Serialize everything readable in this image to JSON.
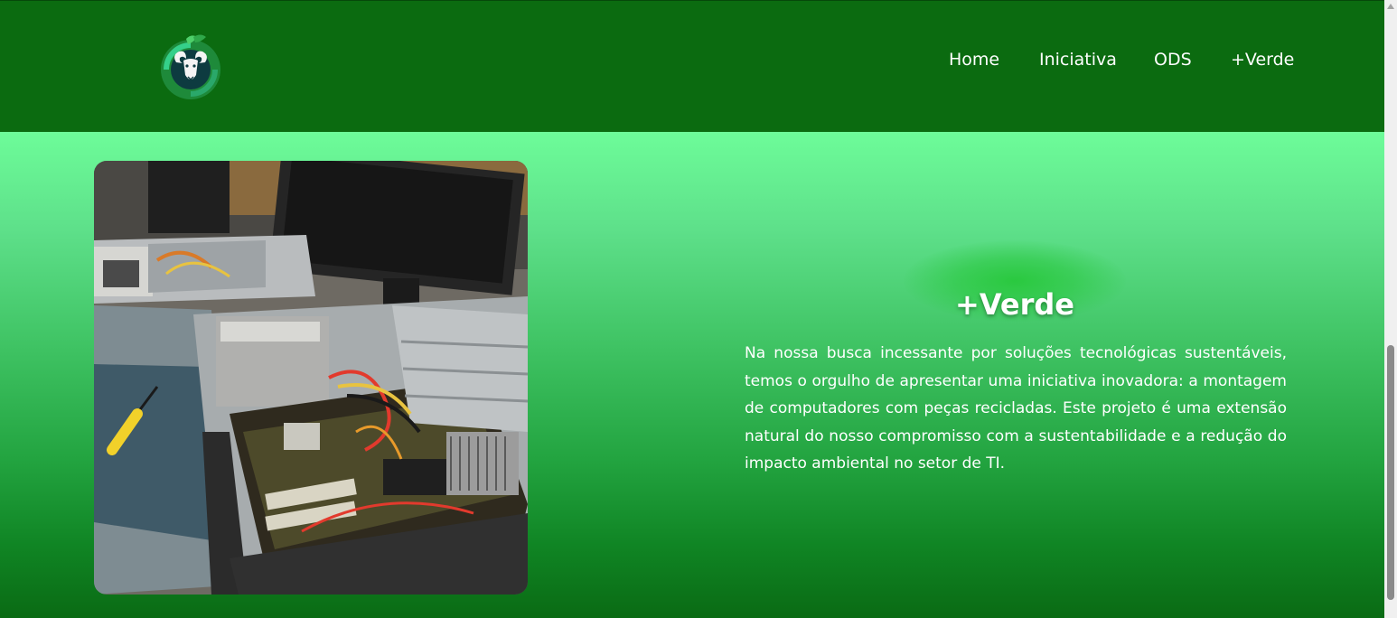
{
  "nav": {
    "logo_icon": "ram-leaf-logo-icon",
    "links": [
      {
        "label": "Home"
      },
      {
        "label": "Iniciativa"
      },
      {
        "label": "ODS"
      },
      {
        "label": "+Verde"
      }
    ]
  },
  "section": {
    "title": "+Verde",
    "body": "Na nossa busca incessante por soluções tecnológicas sustentáveis, temos o orgulho de apresentar uma iniciativa inovadora: a montagem de computadores com peças recicladas. Este projeto é uma extensão natural do nosso compromisso com a sustentabilidade e a redução do impacto ambiental no setor de TI.",
    "image_icon": "computer-repair-photo"
  },
  "colors": {
    "navbar": "#0b6b10",
    "gradient_top": "#6dfc99",
    "gradient_bottom": "#0a6b14",
    "text": "#ffffff"
  }
}
